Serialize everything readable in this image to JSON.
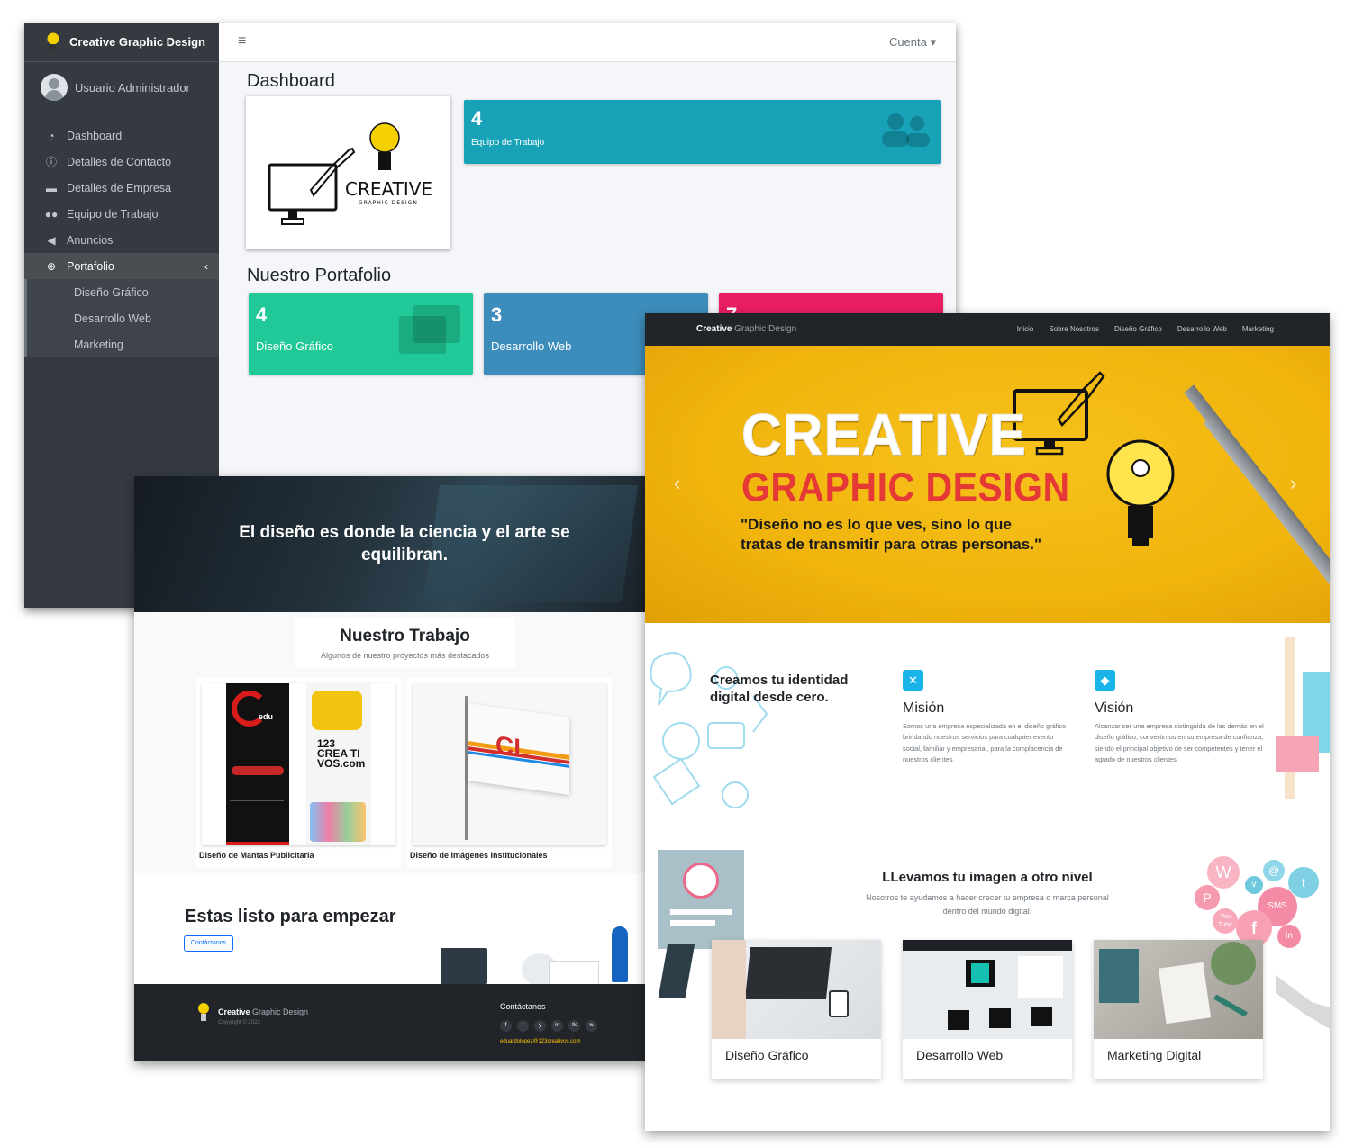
{
  "admin": {
    "brand": "Creative Graphic Design",
    "user": "Usuario Administrador",
    "menu": [
      {
        "label": "Dashboard",
        "icon": "dashboard-icon"
      },
      {
        "label": "Detalles de Contacto",
        "icon": "info-icon"
      },
      {
        "label": "Detalles de Empresa",
        "icon": "briefcase-icon"
      },
      {
        "label": "Equipo de Trabajo",
        "icon": "users-icon"
      },
      {
        "label": "Anuncios",
        "icon": "megaphone-icon"
      },
      {
        "label": "Portafolio",
        "icon": "globe-icon"
      }
    ],
    "submenu": [
      "Diseño Gráfico",
      "Desarrollo Web",
      "Marketing"
    ],
    "account": "Cuenta",
    "title": "Dashboard",
    "logo_word": "CREATIVE",
    "logo_sub": "GRAPHIC DESIGN",
    "team_box": {
      "count": "4",
      "label": "Equipo de Trabajo",
      "color": "#17a2b8"
    },
    "portfolio_title": "Nuestro Portafolio",
    "portfolio_boxes": [
      {
        "count": "4",
        "label": "Diseño Gráfico",
        "color": "#20c997"
      },
      {
        "count": "3",
        "label": "Desarrollo Web",
        "color": "#3c8dbc"
      },
      {
        "count": "7",
        "label": "",
        "color": "#e91e63"
      }
    ]
  },
  "portfolio": {
    "hero": "El diseño es donde la ciencia y el arte se equilibran.",
    "section_title": "Nuestro Trabajo",
    "section_subtitle": "Algunos de nuestro proyectos más destacados",
    "works": [
      {
        "caption": "Diseño de Mantas Publicitaria",
        "left_word": "edu",
        "right_word": "123 CREA TI VOS.com"
      },
      {
        "caption": "Diseño de Imágenes Institucionales",
        "flag_logo": "CL"
      }
    ],
    "cta_title": "Estas listo para empezar",
    "cta_button": "Contáctanos",
    "footer": {
      "brand_bold": "Creative",
      "brand_rest": " Graphic Design",
      "copyright": "Copyright © 2022",
      "contact_title": "Contáctanos",
      "social": [
        "f",
        "t",
        "y",
        "in",
        "tk",
        "w"
      ],
      "email": "eduardolopez@123creativos.com"
    }
  },
  "landing": {
    "brand_bold": "Creative",
    "brand_rest": " Graphic Design",
    "nav": [
      "Inicio",
      "Sobre Nosotros",
      "Diseño Gráfico",
      "Desarrollo Web",
      "Marketing"
    ],
    "hero_line1": "CREATIVE",
    "hero_line2": "GRAPHIC DESIGN",
    "hero_quote": "\"Diseño no es lo que ves, sino lo que tratas de transmitir para otras personas.\"",
    "about_title": "Creamos tu identidad digital desde cero.",
    "mission": {
      "title": "Misión",
      "text": "Somos una empresa especializada en el diseño gráfico brindando nuestros servicios para cualquier evento social, familiar y empresarial, para la complacencia de nuestros clientes."
    },
    "vision": {
      "title": "Visión",
      "text": "Alcanzar ser una empresa distinguida de las demás en el diseño gráfico, convertirnos en su empresa de confianza, siendo el principal objetivo de ser competentes y tener el agrado de nuestros clientes."
    },
    "level_title": "LLevamos tu imagen a otro nivel",
    "level_text": "Nosotros te ayudamos a hacer crecer tu empresa o marca personal dentro del mundo digital.",
    "services": [
      "Diseño Gráfico",
      "Desarrollo Web",
      "Marketing Digital"
    ],
    "social_bubbles": [
      "SMS",
      "f",
      "W",
      "t",
      "@",
      "P",
      "You Tube",
      "v",
      "in"
    ],
    "colors": {
      "accent": "#1ab4e8",
      "hero_yellow": "#f0b40c",
      "hero_red": "#e53935",
      "dark": "#212529"
    }
  }
}
